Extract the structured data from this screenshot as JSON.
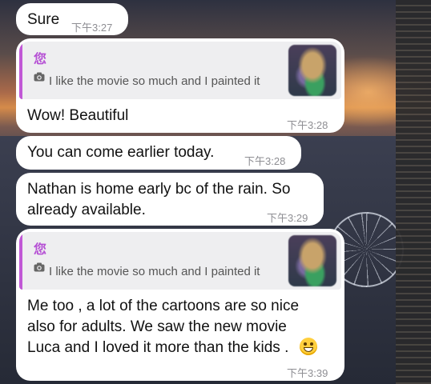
{
  "messages": [
    {
      "text": "Sure",
      "time": "下午3:27"
    },
    {
      "reply": {
        "author": "您",
        "snippet": "I like the movie so much and I painted it",
        "icon": "camera-icon"
      },
      "text": "Wow! Beautiful",
      "time": "下午3:28"
    },
    {
      "text": "You can come earlier today.",
      "time": "下午3:28"
    },
    {
      "lines": [
        "Nathan is home early bc of the rain. So",
        "already available."
      ],
      "time": "下午3:29"
    },
    {
      "reply": {
        "author": "您",
        "snippet": "I like the movie so much and I painted it",
        "icon": "camera-icon"
      },
      "lines": [
        "Me too , a lot of the cartoons are so nice",
        "also for adults. We saw the new movie",
        "Luca and I loved it more than the kids ."
      ],
      "emoji": "grinning-face-emoji",
      "time": "下午3:39"
    }
  ],
  "colors": {
    "bubble": "#ffffff",
    "accent": "#c158d6",
    "timestamp": "#8e8e93",
    "quote_bg": "#eeeef0"
  }
}
